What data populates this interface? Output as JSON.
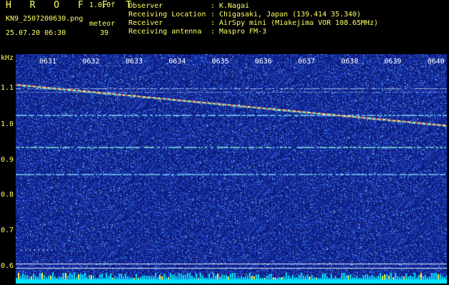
{
  "header": {
    "title": "H R O F F T",
    "version": "1.0.0f",
    "file_name": "KN9_2507200630.png",
    "timestamp": "25.07.20 06:30",
    "meteor_label": "meteor",
    "meteor_count": "39"
  },
  "info": [
    {
      "key": "Observer",
      "value": "K.Nagai"
    },
    {
      "key": "Receiving Location",
      "value": "Chigasaki, Japan (139.414 35.340)"
    },
    {
      "key": "Receiver",
      "value": "AirSpy mini (Miakejima VOR 108.65MHz)"
    },
    {
      "key": "Receiving antenna",
      "value": "Maspro FM-3"
    }
  ],
  "chart_data": {
    "type": "heatmap",
    "ylabel": "kHz",
    "y_ticks": [
      "1.1",
      "1.0",
      "0.9",
      "0.8",
      "0.7",
      "0.6"
    ],
    "x_ticks": [
      "0631",
      "0632",
      "0633",
      "0634",
      "0635",
      "0636",
      "0637",
      "0638",
      "0639",
      "0640"
    ],
    "colors": {
      "background": "#0a1a7a",
      "noise": "#2a4de0",
      "signal": "#7fffd4",
      "trace": "#ff4040",
      "baseline": "#00e5ff"
    }
  }
}
